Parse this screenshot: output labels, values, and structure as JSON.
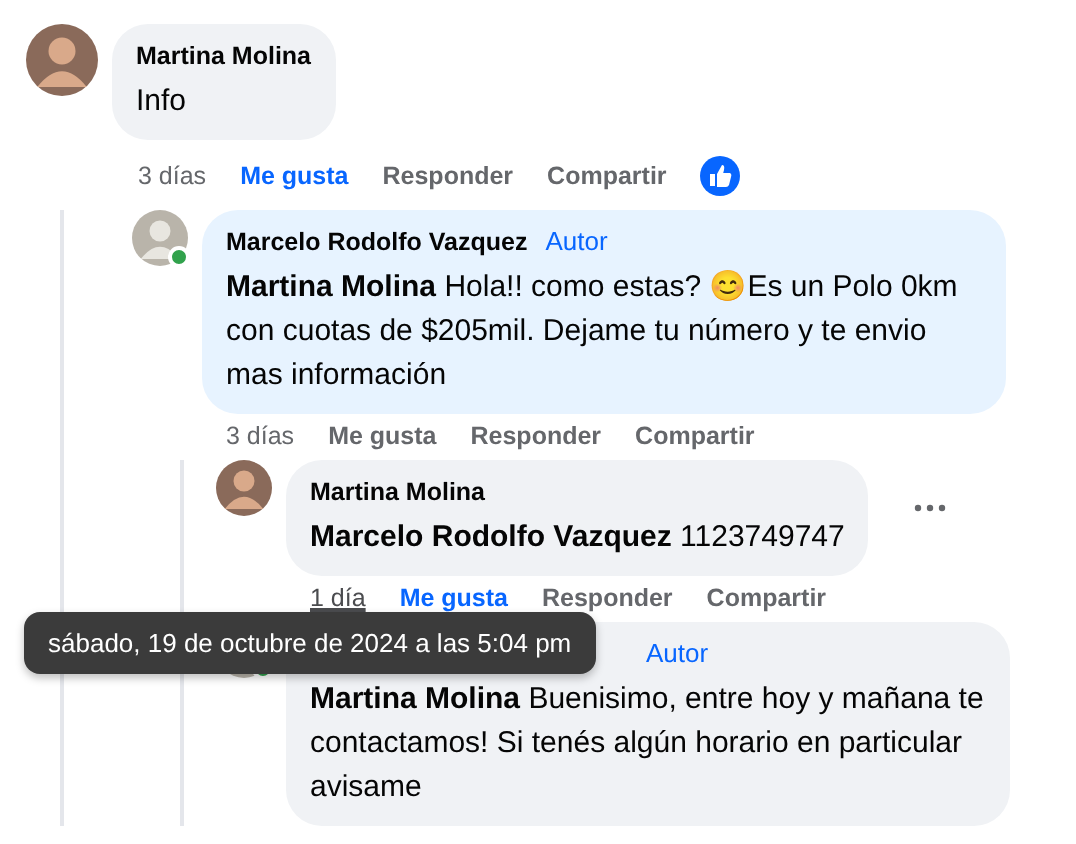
{
  "comments": [
    {
      "author": "Martina Molina",
      "text": "Info",
      "time": "3 días",
      "time_hovered": false,
      "liked": true,
      "reaction": true,
      "color": "#f0f2f5",
      "actions": [
        "Me gusta",
        "Responder",
        "Compartir"
      ],
      "children": [
        {
          "author": "Marcelo Rodolfo Vazquez",
          "badge": "Autor",
          "online": true,
          "mention": "Martina Molina",
          "text": "Hola!! como estas? 😊Es un Polo 0km con cuotas de $205mil. Dejame tu número y te envio mas información",
          "time": "3 días",
          "time_hovered": false,
          "liked": false,
          "color": "#e7f3ff",
          "actions": [
            "Me gusta",
            "Responder",
            "Compartir"
          ],
          "children": [
            {
              "author": "Martina Molina",
              "mention": "Marcelo Rodolfo Vazquez",
              "text": "1123749747",
              "time": "1 día",
              "time_hovered": true,
              "liked": true,
              "more_button": true,
              "color": "#f0f2f5",
              "actions": [
                "Me gusta",
                "Responder",
                "Compartir"
              ]
            },
            {
              "badge": "Autor",
              "online": true,
              "mention": "Martina Molina",
              "text": "Buenisimo, entre hoy y mañana te contactamos! Si tenés algún horario en particular avisame",
              "color": "#f0f2f5"
            }
          ]
        }
      ]
    }
  ],
  "tooltip": {
    "text": "sábado, 19 de octubre de 2024 a las 5:04 pm"
  }
}
